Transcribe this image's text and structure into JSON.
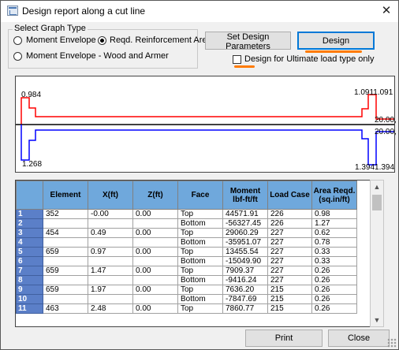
{
  "window": {
    "title": "Design report along a cut line",
    "close_glyph": "✕"
  },
  "graph_type": {
    "legend": "Select Graph Type",
    "options": [
      "Moment Envelope",
      "Reqd. Reinforcement Area",
      "Moment Envelope - Wood and Armer"
    ],
    "selected": "Reqd. Reinforcement Area"
  },
  "buttons": {
    "set_params": "Set Design Parameters",
    "design": "Design",
    "print": "Print",
    "close": "Close"
  },
  "ultimate_only": {
    "label": "Design for Ultimate load type only",
    "checked": false
  },
  "graph": {
    "top_left": "0.984",
    "top_right": "1.0911.091",
    "mid_upper": "20.00,",
    "mid_lower": "20.00,",
    "bottom_left": "1.268",
    "bottom_right": "1.3941.394",
    "colors": {
      "top": "#ff0000",
      "bottom": "#0000ff",
      "axis": "#000000"
    }
  },
  "table": {
    "columns": [
      "Element",
      "X(ft)",
      "Z(ft)",
      "Face",
      "Moment lbf-ft/ft",
      "Load Case",
      "Area Reqd.(sq.in/ft)"
    ],
    "rows": [
      {
        "n": "1",
        "element": "352",
        "x": "-0.00",
        "z": "0.00",
        "face": "Top",
        "moment": "44571.91",
        "lc": "226",
        "area": "0.98"
      },
      {
        "n": "2",
        "element": "",
        "x": "",
        "z": "",
        "face": "Bottom",
        "moment": "-56327.45",
        "lc": "226",
        "area": "1.27"
      },
      {
        "n": "3",
        "element": "454",
        "x": "0.49",
        "z": "0.00",
        "face": "Top",
        "moment": "29060.29",
        "lc": "227",
        "area": "0.62"
      },
      {
        "n": "4",
        "element": "",
        "x": "",
        "z": "",
        "face": "Bottom",
        "moment": "-35951.07",
        "lc": "227",
        "area": "0.78"
      },
      {
        "n": "5",
        "element": "659",
        "x": "0.97",
        "z": "0.00",
        "face": "Top",
        "moment": "13455.54",
        "lc": "227",
        "area": "0.33"
      },
      {
        "n": "6",
        "element": "",
        "x": "",
        "z": "",
        "face": "Bottom",
        "moment": "-15049.90",
        "lc": "227",
        "area": "0.33"
      },
      {
        "n": "7",
        "element": "659",
        "x": "1.47",
        "z": "0.00",
        "face": "Top",
        "moment": "7909.37",
        "lc": "227",
        "area": "0.26"
      },
      {
        "n": "8",
        "element": "",
        "x": "",
        "z": "",
        "face": "Bottom",
        "moment": "-9416.24",
        "lc": "227",
        "area": "0.26"
      },
      {
        "n": "9",
        "element": "659",
        "x": "1.97",
        "z": "0.00",
        "face": "Top",
        "moment": "7636.20",
        "lc": "215",
        "area": "0.26"
      },
      {
        "n": "10",
        "element": "",
        "x": "",
        "z": "",
        "face": "Bottom",
        "moment": "-7847.69",
        "lc": "215",
        "area": "0.26"
      },
      {
        "n": "11",
        "element": "463",
        "x": "2.48",
        "z": "0.00",
        "face": "Top",
        "moment": "7860.77",
        "lc": "215",
        "area": "0.26"
      }
    ]
  },
  "scrollbar": {
    "up": "▲",
    "down": "▼"
  },
  "annotation_color": "#ff7a00"
}
